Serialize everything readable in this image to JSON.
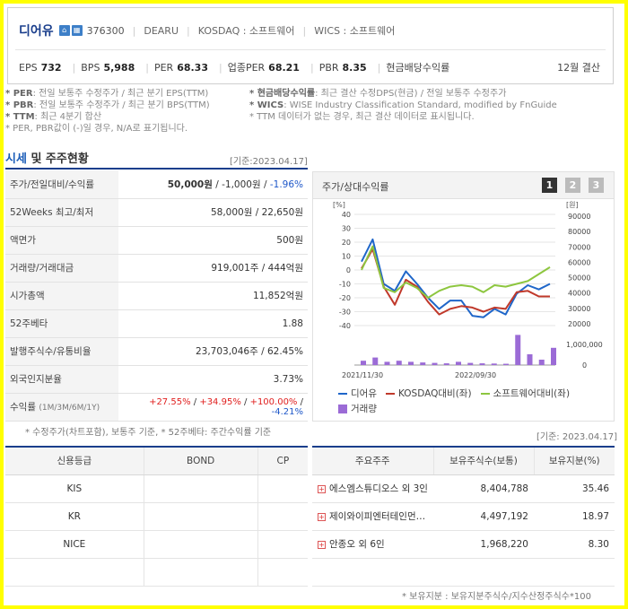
{
  "company": {
    "name": "디어유",
    "code": "376300",
    "english": "DEARU",
    "market": "KOSDAQ : 소프트웨어",
    "wics": "WICS : 소프트웨어",
    "icon1": "home-icon",
    "icon2": "building-icon"
  },
  "metrics": [
    {
      "label": "EPS",
      "value": "732"
    },
    {
      "label": "BPS",
      "value": "5,988"
    },
    {
      "label": "PER",
      "value": "68.33"
    },
    {
      "label": "업종PER",
      "value": "68.21"
    },
    {
      "label": "PBR",
      "value": "8.35"
    },
    {
      "label": "현금배당수익률",
      "value": ""
    }
  ],
  "settlement": "12월 결산",
  "notes_left": [
    {
      "key": "* PER",
      "text": ": 전일 보통주 수정주가 / 최근 분기 EPS(TTM)"
    },
    {
      "key": "* PBR",
      "text": ": 전일 보통주 수정주가 / 최근 분기 BPS(TTM)"
    },
    {
      "key": "* TTM",
      "text": ": 최근 4분기 합산"
    },
    {
      "key": "",
      "text": "* PER, PBR값이 (-)일 경우, N/A로 표기됩니다."
    }
  ],
  "notes_right": [
    {
      "key": "* 현금배당수익률",
      "text": ": 최근 결산 수정DPS(현금) / 전일 보통주 수정주가"
    },
    {
      "key": "* WICS",
      "text": ": WISE Industry Classification Standard, modified by FnGuide"
    },
    {
      "key": "",
      "text": "* TTM 데이터가 없는 경우, 최근 결산 데이터로 표시됩니다."
    }
  ],
  "section": {
    "title_blue": "시세",
    "title_rest": " 및 주주현황",
    "date": "[기준:2023.04.17]"
  },
  "sise_rows": [
    {
      "label": "주가/전일대비/수익률",
      "v1": "50,000원",
      "v2": " / -1,000원 / ",
      "v3": "-1.96%"
    },
    {
      "label": "52Weeks 최고/최저",
      "value": "58,000원 / 22,650원"
    },
    {
      "label": "액면가",
      "value": "500원"
    },
    {
      "label": "거래량/거래대금",
      "value": "919,001주 / 444억원"
    },
    {
      "label": "시가총액",
      "value": "11,852억원"
    },
    {
      "label": "52주베타",
      "value": "1.88"
    },
    {
      "label": "발행주식수/유통비율",
      "value": "23,703,046주 / 62.45%"
    },
    {
      "label": "외국인지분율",
      "value": "3.73%"
    }
  ],
  "returns_row": {
    "label": "수익률",
    "label_sub": "(1M/3M/6M/1Y)",
    "r1": "+27.55%",
    "s1": " / ",
    "r2": "+34.95%",
    "s2": " / ",
    "r3": "+100.00%",
    "s3": " / ",
    "r4": "-4.21%"
  },
  "sise_footnote": "* 수정주가(차트포함), 보통주 기준, * 52주베타: 주간수익률 기준",
  "chart_panel": {
    "title": "주가/상대수익률",
    "pages": [
      "1",
      "2",
      "3"
    ],
    "left_unit": "[%]",
    "right_unit": "[원]"
  },
  "chart_data": {
    "type": "line",
    "x_labels": [
      "2021/11/30",
      "2022/09/30"
    ],
    "yleft_ticks": [
      "40",
      "30",
      "20",
      "10",
      "0",
      "-10",
      "-20",
      "-30",
      "-40"
    ],
    "yright_ticks": [
      "90000",
      "80000",
      "70000",
      "60000",
      "50000",
      "40000",
      "30000",
      "20000"
    ],
    "volume_ticks": [
      "1,000,000",
      "0"
    ],
    "ylim": [
      -40,
      40
    ],
    "series": [
      {
        "name": "디어유",
        "color": "#1f66c9",
        "values": [
          6,
          22,
          -10,
          -15,
          -1,
          -10,
          -20,
          -28,
          -22,
          -22,
          -33,
          -34,
          -28,
          -32,
          -17,
          -11,
          -14,
          -10
        ]
      },
      {
        "name": "KOSDAQ대비(좌)",
        "color": "#c0392b",
        "values": [
          1,
          15,
          -12,
          -25,
          -7,
          -12,
          -23,
          -32,
          -28,
          -26,
          -27,
          -30,
          -27,
          -28,
          -16,
          -15,
          -19,
          -19
        ]
      },
      {
        "name": "소프트웨어대비(좌)",
        "color": "#8dc63f",
        "values": [
          0,
          17,
          -13,
          -16,
          -9,
          -13,
          -20,
          -15,
          -12,
          -11,
          -12,
          -16,
          -11,
          -12,
          -10,
          -8,
          -3,
          2
        ]
      }
    ],
    "volume": {
      "name": "거래량",
      "color": "#9b6bd6",
      "values": [
        200000,
        350000,
        150000,
        200000,
        150000,
        120000,
        100000,
        80000,
        150000,
        100000,
        80000,
        70000,
        60000,
        1400000,
        500000,
        250000,
        800000
      ]
    }
  },
  "credit": {
    "headers": [
      "신용등급",
      "BOND",
      "CP"
    ],
    "rows": [
      [
        "KIS",
        "",
        ""
      ],
      [
        "KR",
        "",
        ""
      ],
      [
        "NICE",
        "",
        ""
      ],
      [
        "",
        "",
        ""
      ]
    ]
  },
  "holders": {
    "date": "[기준: 2023.04.17]",
    "headers": [
      "주요주주",
      "보유주식수(보통)",
      "보유지분(%)"
    ],
    "rows": [
      {
        "name": "에스엠스튜디오스 외 3인",
        "shares": "8,404,788",
        "pct": "35.46"
      },
      {
        "name": "제이와이피엔터테인먼…",
        "shares": "4,497,192",
        "pct": "18.97"
      },
      {
        "name": "안종오 외 6인",
        "shares": "1,968,220",
        "pct": "8.30"
      },
      {
        "name": "",
        "shares": "",
        "pct": ""
      }
    ]
  },
  "holders_note": "* 보유지분 : 보유지분주식수/지수산정주식수*100"
}
